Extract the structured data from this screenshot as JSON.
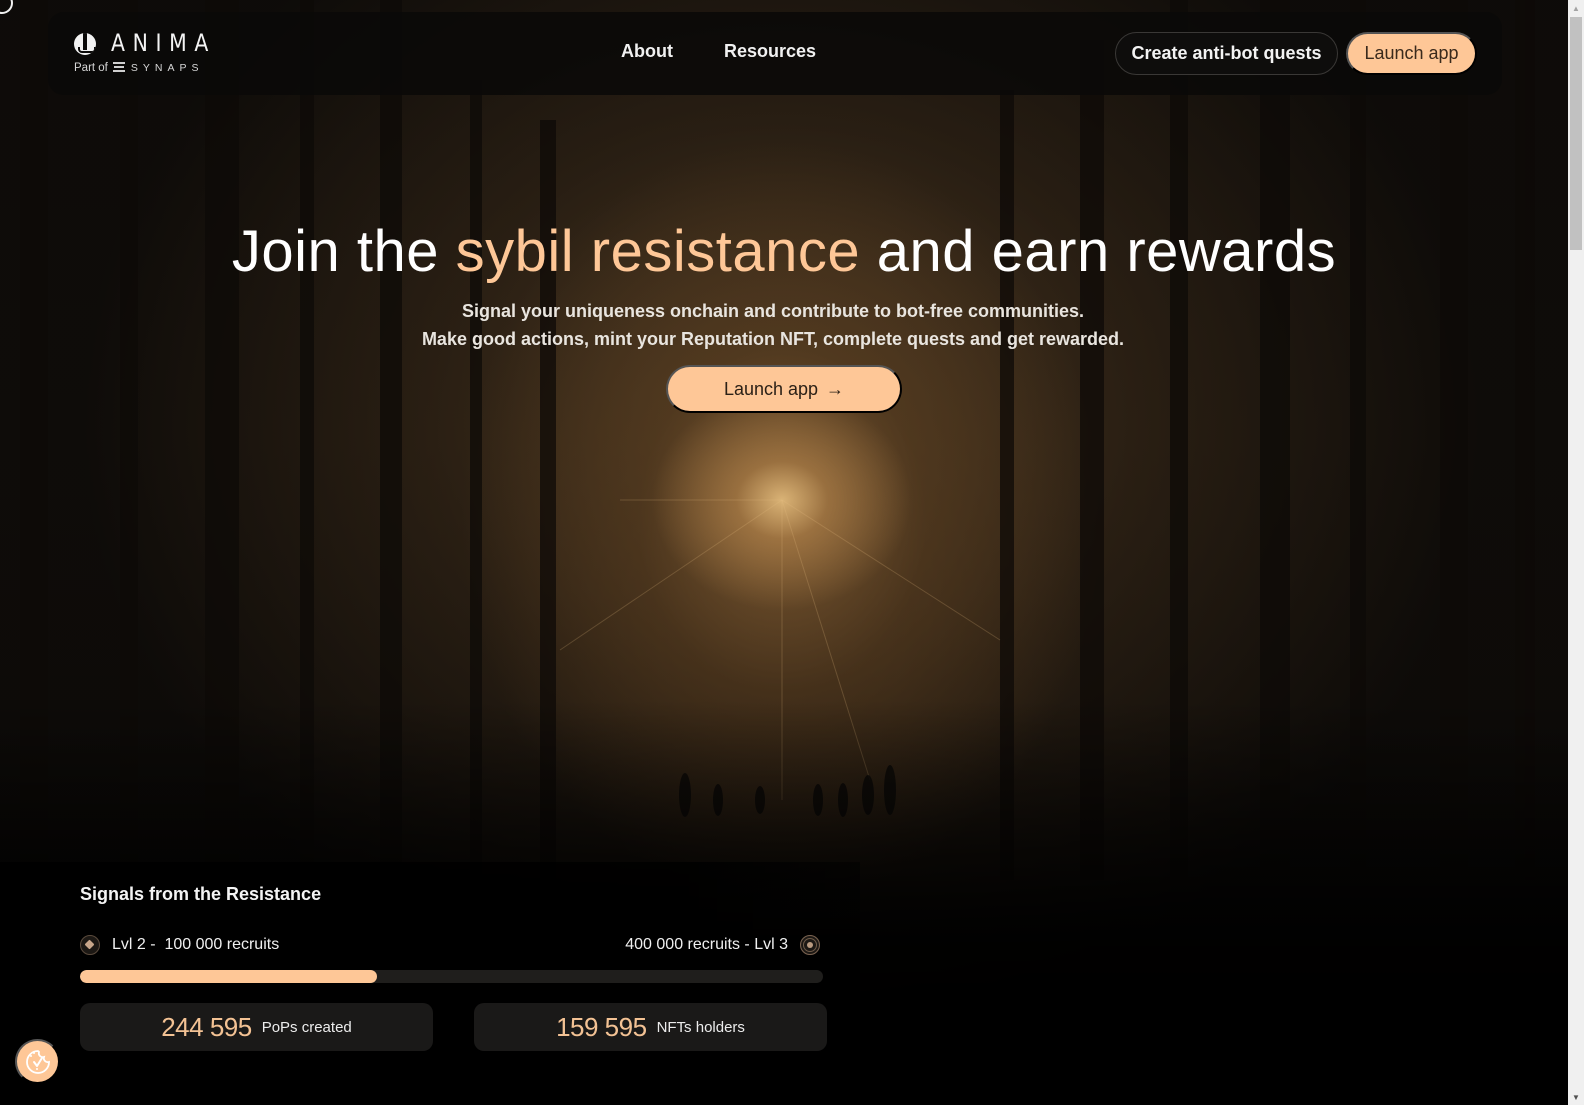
{
  "header": {
    "logo": {
      "name": "ANIMA",
      "sub_prefix": "Part of",
      "partner": "SYNAPS"
    },
    "nav": [
      {
        "label": "About"
      },
      {
        "label": "Resources"
      }
    ],
    "buttons": {
      "create_quests": "Create anti-bot quests",
      "launch_app": "Launch app"
    }
  },
  "hero": {
    "title_part1": "Join the ",
    "title_accent": "sybil resistance",
    "title_part2": " and earn rewards",
    "subtitle_line1": "Signal your uniqueness onchain and contribute to bot-free communities.",
    "subtitle_line2": "Make good actions, mint your Reputation NFT, complete quests and get rewarded.",
    "cta_label": "Launch app",
    "cta_arrow": "→"
  },
  "signals": {
    "title": "Signals from the Resistance",
    "level_from": {
      "label": "Lvl 2 -  100 000 recruits",
      "icon": "level-badge-diamond"
    },
    "level_to": {
      "label": "400 000 recruits - Lvl 3",
      "icon": "level-badge-ring"
    },
    "progress_fraction": 0.4,
    "stats": [
      {
        "value": "244 595",
        "label": "PoPs created"
      },
      {
        "value": "159 595",
        "label": "NFTs holders"
      }
    ]
  },
  "cookie_button": {
    "icon": "cookie-check-icon"
  },
  "colors": {
    "accent": "#fec797",
    "stat_value": "#f3c294",
    "header_bg": "#0a0908",
    "card_bg": "#1a1918"
  }
}
